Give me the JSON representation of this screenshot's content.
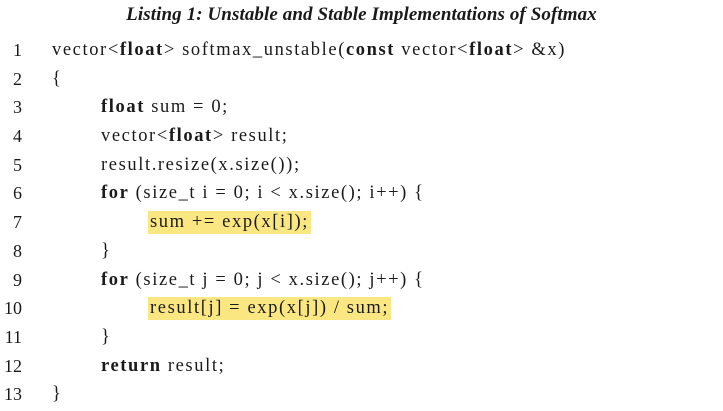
{
  "caption": "Listing 1: Unstable and Stable Implementations of Softmax",
  "lines": [
    {
      "num": "1",
      "segs": [
        "vector<",
        "float",
        "> softmax_unstable(",
        "const",
        " vector<",
        "float",
        "> &x)"
      ]
    },
    {
      "num": "2",
      "segs": [
        "{"
      ]
    },
    {
      "num": "3",
      "segs": [
        "float",
        " sum = 0;"
      ]
    },
    {
      "num": "4",
      "segs": [
        "vector<",
        "float",
        "> result;"
      ]
    },
    {
      "num": "5",
      "segs": [
        "result.resize(x.size());"
      ]
    },
    {
      "num": "6",
      "segs": [
        "for",
        " (size_t i = 0; i < x.size(); i++) {"
      ]
    },
    {
      "num": "7",
      "segs": [
        "sum += exp(x[i]);"
      ]
    },
    {
      "num": "8",
      "segs": [
        "}"
      ]
    },
    {
      "num": "9",
      "segs": [
        "for",
        " (size_t j = 0; j < x.size(); j++) {"
      ]
    },
    {
      "num": "10",
      "segs": [
        "result[j] = exp(x[j]) / sum;"
      ]
    },
    {
      "num": "11",
      "segs": [
        "}"
      ]
    },
    {
      "num": "12",
      "segs": [
        "return",
        " result;"
      ]
    },
    {
      "num": "13",
      "segs": [
        "}"
      ]
    }
  ],
  "highlight_color": "#fbe782"
}
